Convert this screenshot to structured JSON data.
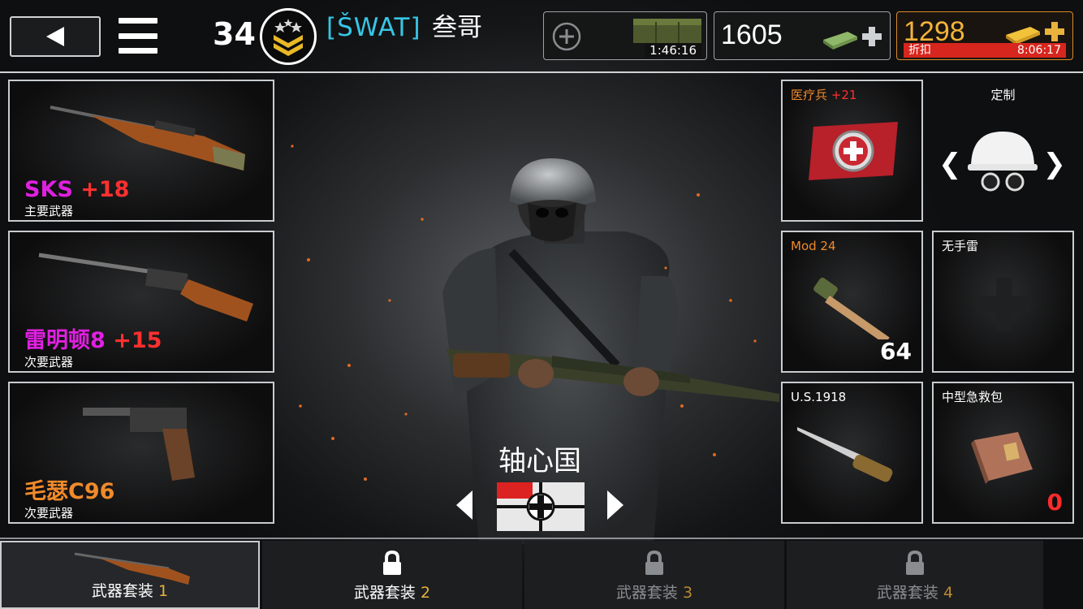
{
  "header": {
    "back_icon": "back-arrow-icon",
    "menu_icon": "hamburger-menu-icon",
    "level": "34",
    "clan_tag": "[ŠWAT]",
    "player_name": "叁哥",
    "crate_timer": "1:46:16",
    "cash": "1605",
    "gold": "1298",
    "sale_label": "折扣",
    "sale_timer": "8:06:17"
  },
  "weapons": [
    {
      "name": "SKS",
      "bonus": "+18",
      "type": "主要武器",
      "color": "#e020e0"
    },
    {
      "name": "雷明顿8",
      "bonus": "+15",
      "type": "次要武器",
      "color": "#e020e0"
    },
    {
      "name": "毛瑟C96",
      "bonus": "",
      "type": "次要武器",
      "color": "#f08a2a"
    }
  ],
  "class_slot": {
    "title": "医疗兵",
    "bonus": "+21"
  },
  "customize": {
    "title": "定制"
  },
  "gear": [
    {
      "title": "Mod 24",
      "count": "64",
      "title_color": "#f08a2a"
    },
    {
      "title": "无手雷",
      "count": "",
      "title_color": "#ffffff"
    },
    {
      "title": "U.S.1918",
      "count": "",
      "title_color": "#ffffff"
    },
    {
      "title": "中型急救包",
      "count": "0",
      "title_color": "#ffffff"
    }
  ],
  "faction": {
    "name": "轴心国"
  },
  "loadouts": [
    {
      "label": "武器套装",
      "num": "1",
      "locked": false
    },
    {
      "label": "武器套装",
      "num": "2",
      "locked": true
    },
    {
      "label": "武器套装",
      "num": "3",
      "locked": true
    },
    {
      "label": "武器套装",
      "num": "4",
      "locked": true
    }
  ],
  "colors": {
    "accent_cyan": "#36c6e6",
    "gold_border": "#d98a2a",
    "sale_red": "#d7261e",
    "bonus_red": "#ff3030"
  }
}
